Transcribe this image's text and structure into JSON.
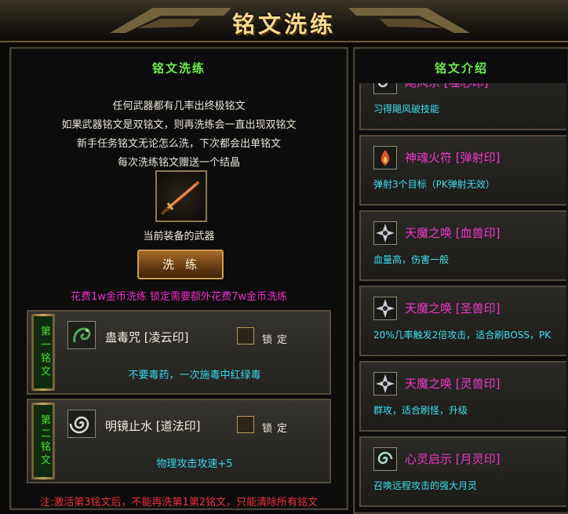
{
  "window": {
    "title": "铭文洗练"
  },
  "left": {
    "heading": "铭文洗练",
    "rules": [
      "任何武器都有几率出终极铭文",
      "如果武器铭文是双铭文，则再洗练会一直出现双铭文",
      "新手任务铭文无论怎么洗，下次都会出单铭文",
      "每次洗练铭文赠送一个结晶"
    ],
    "weapon_caption": "当前装备的武器",
    "wash_button": "洗练",
    "cost_text": "花费1w金币洗练  锁定需要额外花费7w金币洗练",
    "slots": [
      {
        "tag": "第一铭文",
        "icon": "poison-rune-icon",
        "name": "蛊毒咒 [凌云印]",
        "lock": "锁定",
        "desc": "不要毒药，一次施毒中红绿毒"
      },
      {
        "tag": "第二铭文",
        "icon": "swirl-rune-icon",
        "name": "明镜止水 [道法印]",
        "lock": "锁定",
        "desc": "物理攻击攻速+5"
      }
    ],
    "note": "注:激活第3铭文后，不能再洗第1第2铭文，只能清除所有铭文"
  },
  "right": {
    "heading": "铭文介绍",
    "cards": [
      {
        "icon": "whirl-rune-icon",
        "title": "飓风杀 [噬心印]",
        "desc": "习得飓风破技能"
      },
      {
        "icon": "fire-rune-icon",
        "title": "神魂火符 [弹射印]",
        "desc": "弹射3个目标（PK弹射无效）"
      },
      {
        "icon": "star-rune-icon",
        "title": "天魔之唤 [血兽印]",
        "desc": "血量高，伤害一般"
      },
      {
        "icon": "star-rune-icon",
        "title": "天魔之唤 [圣兽印]",
        "desc": "20%几率触发2倍攻击，适合刷BOSS，PK"
      },
      {
        "icon": "star-rune-icon",
        "title": "天魔之唤 [灵兽印]",
        "desc": "群攻，适合刷怪，升级"
      },
      {
        "icon": "spirit-rune-icon",
        "title": "心灵启示 [月灵印]",
        "desc": "召唤远程攻击的强大月灵"
      }
    ]
  },
  "colors": {
    "heading": "#6cf04a",
    "cost": "#f02fd0",
    "desc": "#36d7e8",
    "note": "#f0303a",
    "card_title": "#f038c8"
  }
}
